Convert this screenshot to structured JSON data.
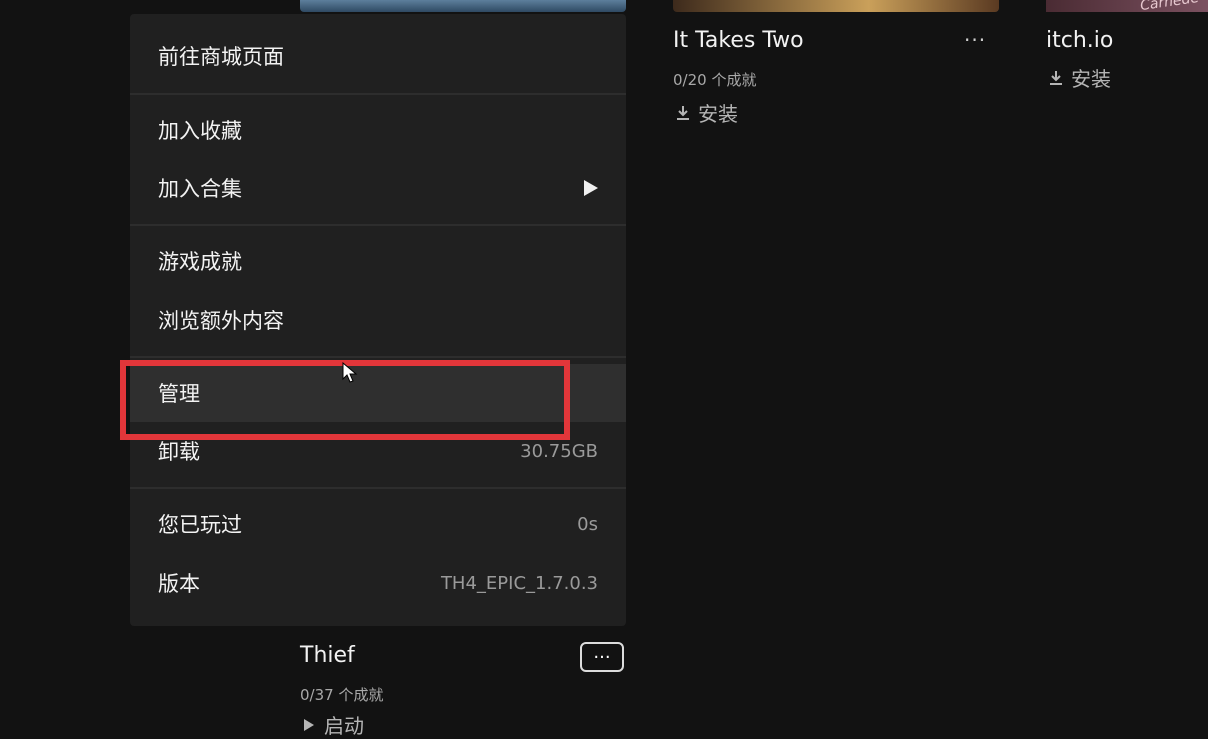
{
  "games": {
    "thief": {
      "title": "Thief",
      "achievements": "0/37 个成就",
      "action": "启动"
    },
    "it_takes_two": {
      "title": "It Takes Two",
      "achievements": "0/20 个成就",
      "action": "安装"
    },
    "itch": {
      "title": "itch.io",
      "action": "安装",
      "thumb_text": "Carnede"
    }
  },
  "more_label": "···",
  "menu": {
    "items": [
      {
        "key": "store",
        "label": "前往商城页面"
      },
      {
        "key": "favorite",
        "label": "加入收藏"
      },
      {
        "key": "collection",
        "label": "加入合集",
        "has_submenu": true
      },
      {
        "key": "achievements",
        "label": "游戏成就"
      },
      {
        "key": "addons",
        "label": "浏览额外内容"
      },
      {
        "key": "manage",
        "label": "管理",
        "hovered": true
      },
      {
        "key": "uninstall",
        "label": "卸载",
        "value": "30.75GB"
      },
      {
        "key": "played",
        "label": "您已玩过",
        "value": "0s"
      },
      {
        "key": "version",
        "label": "版本",
        "value": "TH4_EPIC_1.7.0.3"
      }
    ]
  },
  "colors": {
    "background": "#121212",
    "menu_bg": "#202020",
    "menu_hover": "#2f2f2f",
    "highlight_red": "#e2363a"
  }
}
